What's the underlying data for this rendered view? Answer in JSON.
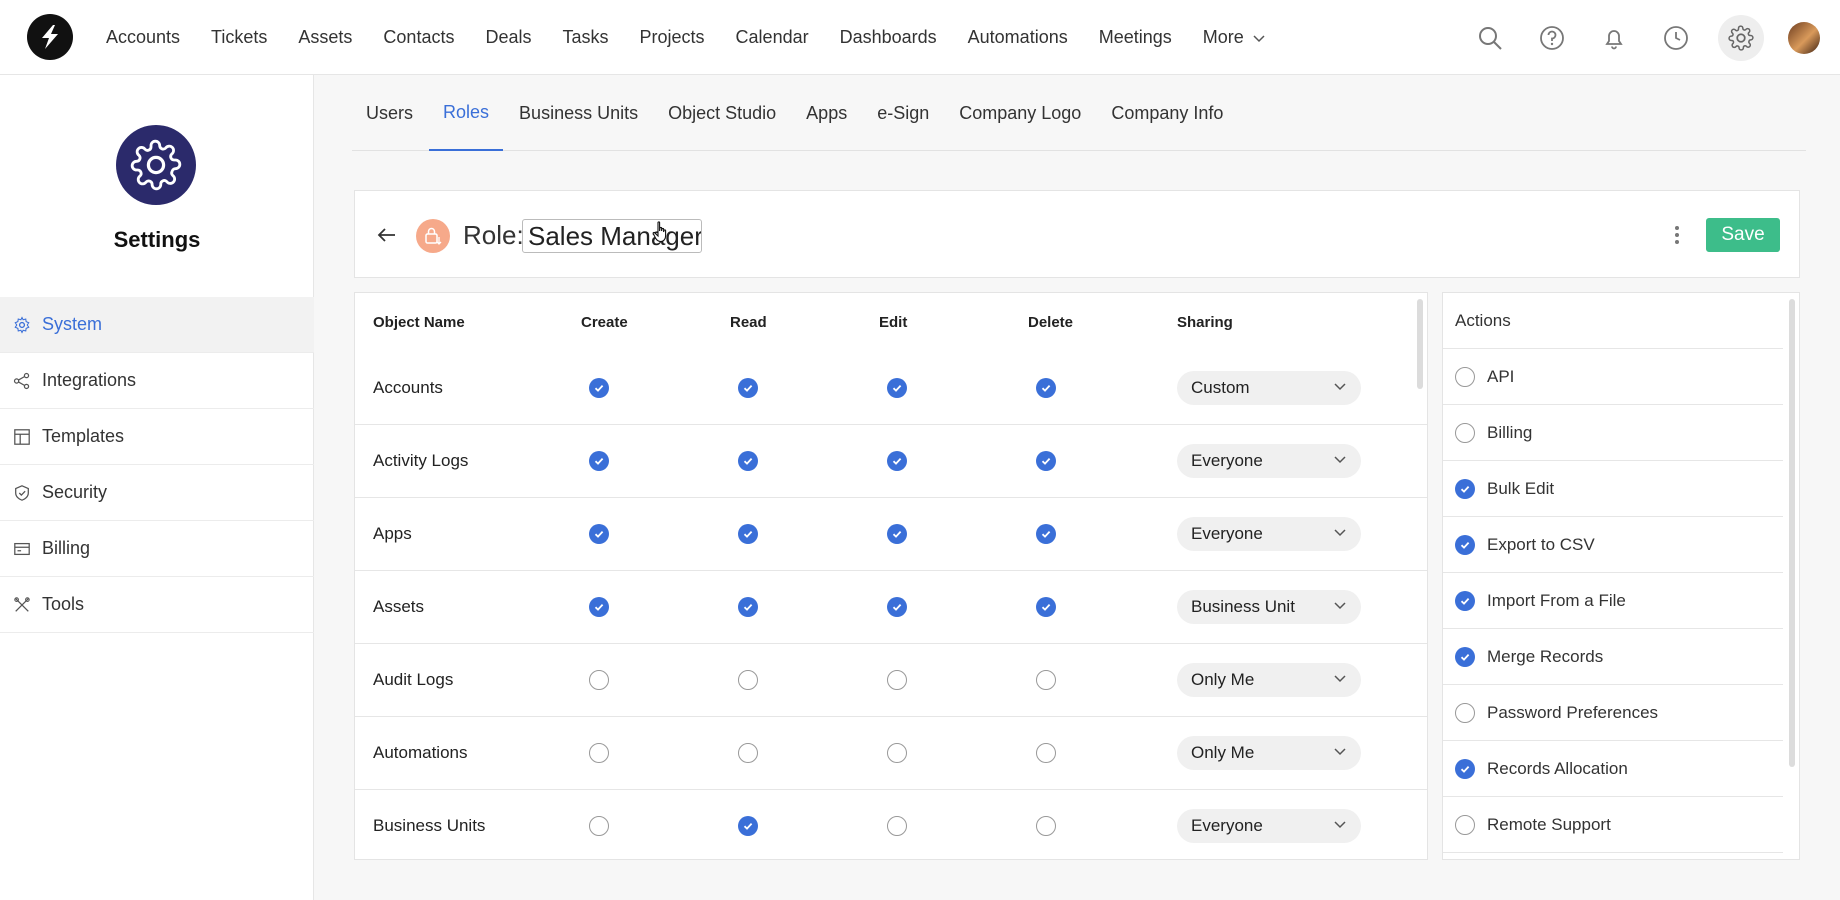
{
  "nav": {
    "items": [
      "Accounts",
      "Tickets",
      "Assets",
      "Contacts",
      "Deals",
      "Tasks",
      "Projects",
      "Calendar",
      "Dashboards",
      "Automations",
      "Meetings"
    ],
    "more_label": "More"
  },
  "sidebar": {
    "title": "Settings",
    "items": [
      {
        "label": "System",
        "icon": "gear-icon",
        "active": true
      },
      {
        "label": "Integrations",
        "icon": "share-icon",
        "active": false
      },
      {
        "label": "Templates",
        "icon": "layout-icon",
        "active": false
      },
      {
        "label": "Security",
        "icon": "shield-icon",
        "active": false
      },
      {
        "label": "Billing",
        "icon": "card-icon",
        "active": false
      },
      {
        "label": "Tools",
        "icon": "tools-icon",
        "active": false
      }
    ]
  },
  "tabs": [
    "Users",
    "Roles",
    "Business Units",
    "Object Studio",
    "Apps",
    "e-Sign",
    "Company Logo",
    "Company Info"
  ],
  "active_tab": "Roles",
  "role": {
    "prefix": "Role:",
    "name": "Sales Manager",
    "save_label": "Save"
  },
  "permissions": {
    "headers": {
      "name": "Object Name",
      "create": "Create",
      "read": "Read",
      "edit": "Edit",
      "delete": "Delete",
      "sharing": "Sharing"
    },
    "rows": [
      {
        "name": "Accounts",
        "create": true,
        "read": true,
        "edit": true,
        "delete": true,
        "sharing": "Custom"
      },
      {
        "name": "Activity Logs",
        "create": true,
        "read": true,
        "edit": true,
        "delete": true,
        "sharing": "Everyone"
      },
      {
        "name": "Apps",
        "create": true,
        "read": true,
        "edit": true,
        "delete": true,
        "sharing": "Everyone"
      },
      {
        "name": "Assets",
        "create": true,
        "read": true,
        "edit": true,
        "delete": true,
        "sharing": "Business Unit"
      },
      {
        "name": "Audit Logs",
        "create": false,
        "read": false,
        "edit": false,
        "delete": false,
        "sharing": "Only Me"
      },
      {
        "name": "Automations",
        "create": false,
        "read": false,
        "edit": false,
        "delete": false,
        "sharing": "Only Me"
      },
      {
        "name": "Business Units",
        "create": false,
        "read": true,
        "edit": false,
        "delete": false,
        "sharing": "Everyone"
      }
    ]
  },
  "actions": {
    "title": "Actions",
    "items": [
      {
        "label": "API",
        "checked": false
      },
      {
        "label": "Billing",
        "checked": false
      },
      {
        "label": "Bulk Edit",
        "checked": true
      },
      {
        "label": "Export to CSV",
        "checked": true
      },
      {
        "label": "Import From a File",
        "checked": true
      },
      {
        "label": "Merge Records",
        "checked": true
      },
      {
        "label": "Password Preferences",
        "checked": false
      },
      {
        "label": "Records Allocation",
        "checked": true
      },
      {
        "label": "Remote Support",
        "checked": false
      }
    ]
  },
  "colors": {
    "accent": "#3a6fd8",
    "save": "#3dbd8a",
    "settings_badge": "#2b2a6b",
    "role_icon": "#f6a98a"
  }
}
